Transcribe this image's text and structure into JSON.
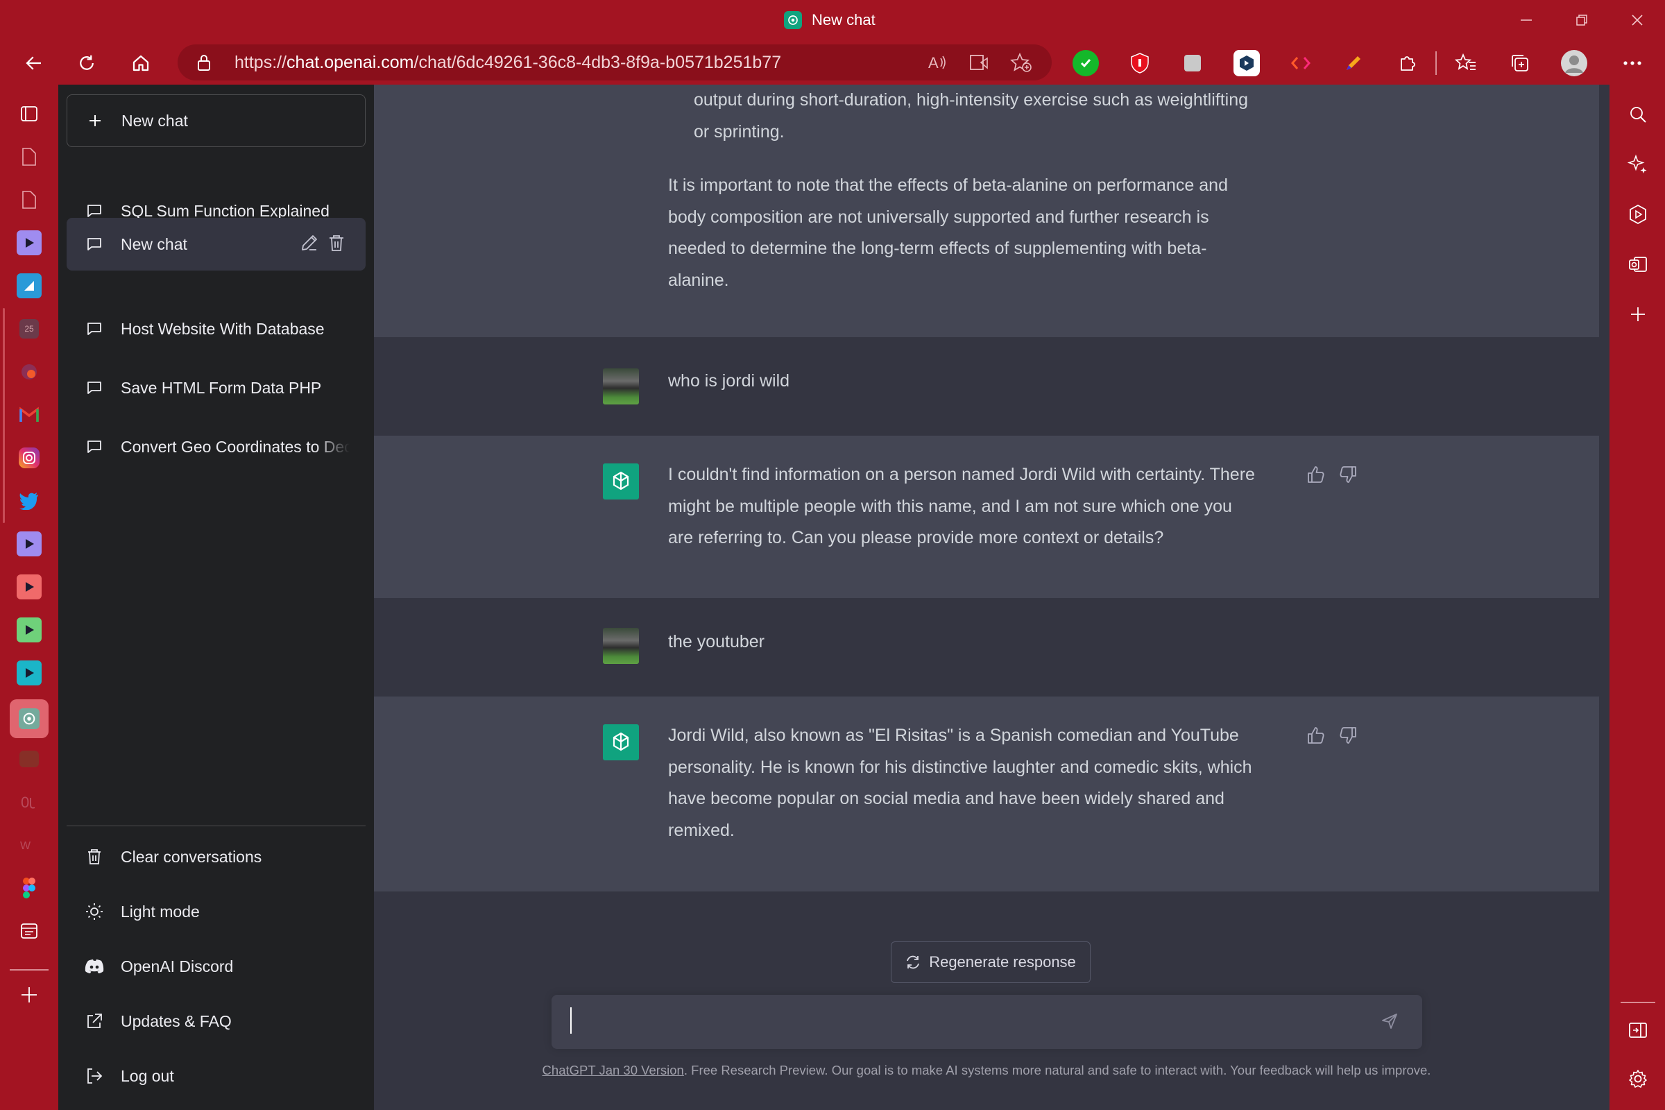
{
  "window": {
    "title": "New chat"
  },
  "browser": {
    "url_prefix": "https://",
    "url_host": "chat.openai.com",
    "url_path": "/chat/6dc49261-36c8-4db3-8f9a-b0571b251b77"
  },
  "sidebar": {
    "new_chat_label": "New chat",
    "chats": [
      {
        "label": "SQL Sum Function Explained"
      },
      {
        "label": "New chat"
      },
      {
        "label": "Host Website With Database"
      },
      {
        "label": "Save HTML Form Data PHP"
      },
      {
        "label": "Convert Geo Coordinates to Deci"
      }
    ],
    "menu": [
      {
        "label": "Clear conversations",
        "icon": "trash-icon"
      },
      {
        "label": "Light mode",
        "icon": "sun-icon"
      },
      {
        "label": "OpenAI Discord",
        "icon": "discord-icon"
      },
      {
        "label": "Updates & FAQ",
        "icon": "external-link-icon"
      },
      {
        "label": "Log out",
        "icon": "logout-icon"
      }
    ]
  },
  "conversation": {
    "partial_list_item": {
      "line1": "output during short-duration, high-intensity exercise such as weightlifting",
      "line2": "or sprinting."
    },
    "partial_paragraph": {
      "line1": "It is important to note that the effects of beta-alanine on performance and",
      "line2": "body composition are not universally supported and further research is",
      "line3": "needed to determine the long-term effects of supplementing with beta-",
      "line4": "alanine."
    },
    "messages": [
      {
        "role": "user",
        "text": "who is jordi wild"
      },
      {
        "role": "assistant",
        "line1": "I couldn't find information on a person named Jordi Wild with certainty. There",
        "line2": "might be multiple people with this name, and I am not sure which one you",
        "line3": "are referring to. Can you please provide more context or details?"
      },
      {
        "role": "user",
        "text": "the youtuber"
      },
      {
        "role": "assistant",
        "line1": "Jordi Wild, also known as \"El Risitas\" is a Spanish comedian and YouTube",
        "line2": "personality. He is known for his distinctive laughter and comedic skits, which",
        "line3": "have become popular on social media and have been widely shared and",
        "line4": "remixed."
      }
    ]
  },
  "composer": {
    "regenerate_label": "Regenerate response",
    "input_value": ""
  },
  "footer": {
    "version_link": "ChatGPT Jan 30 Version",
    "text": ". Free Research Preview. Our goal is to make AI systems more natural and safe to interact with. Your feedback will help us improve."
  },
  "colors": {
    "browser_frame": "#a31422",
    "sidebar_bg": "#202123",
    "chat_bg": "#343541",
    "assistant_bg": "#444654",
    "brand_green": "#10a37f"
  }
}
